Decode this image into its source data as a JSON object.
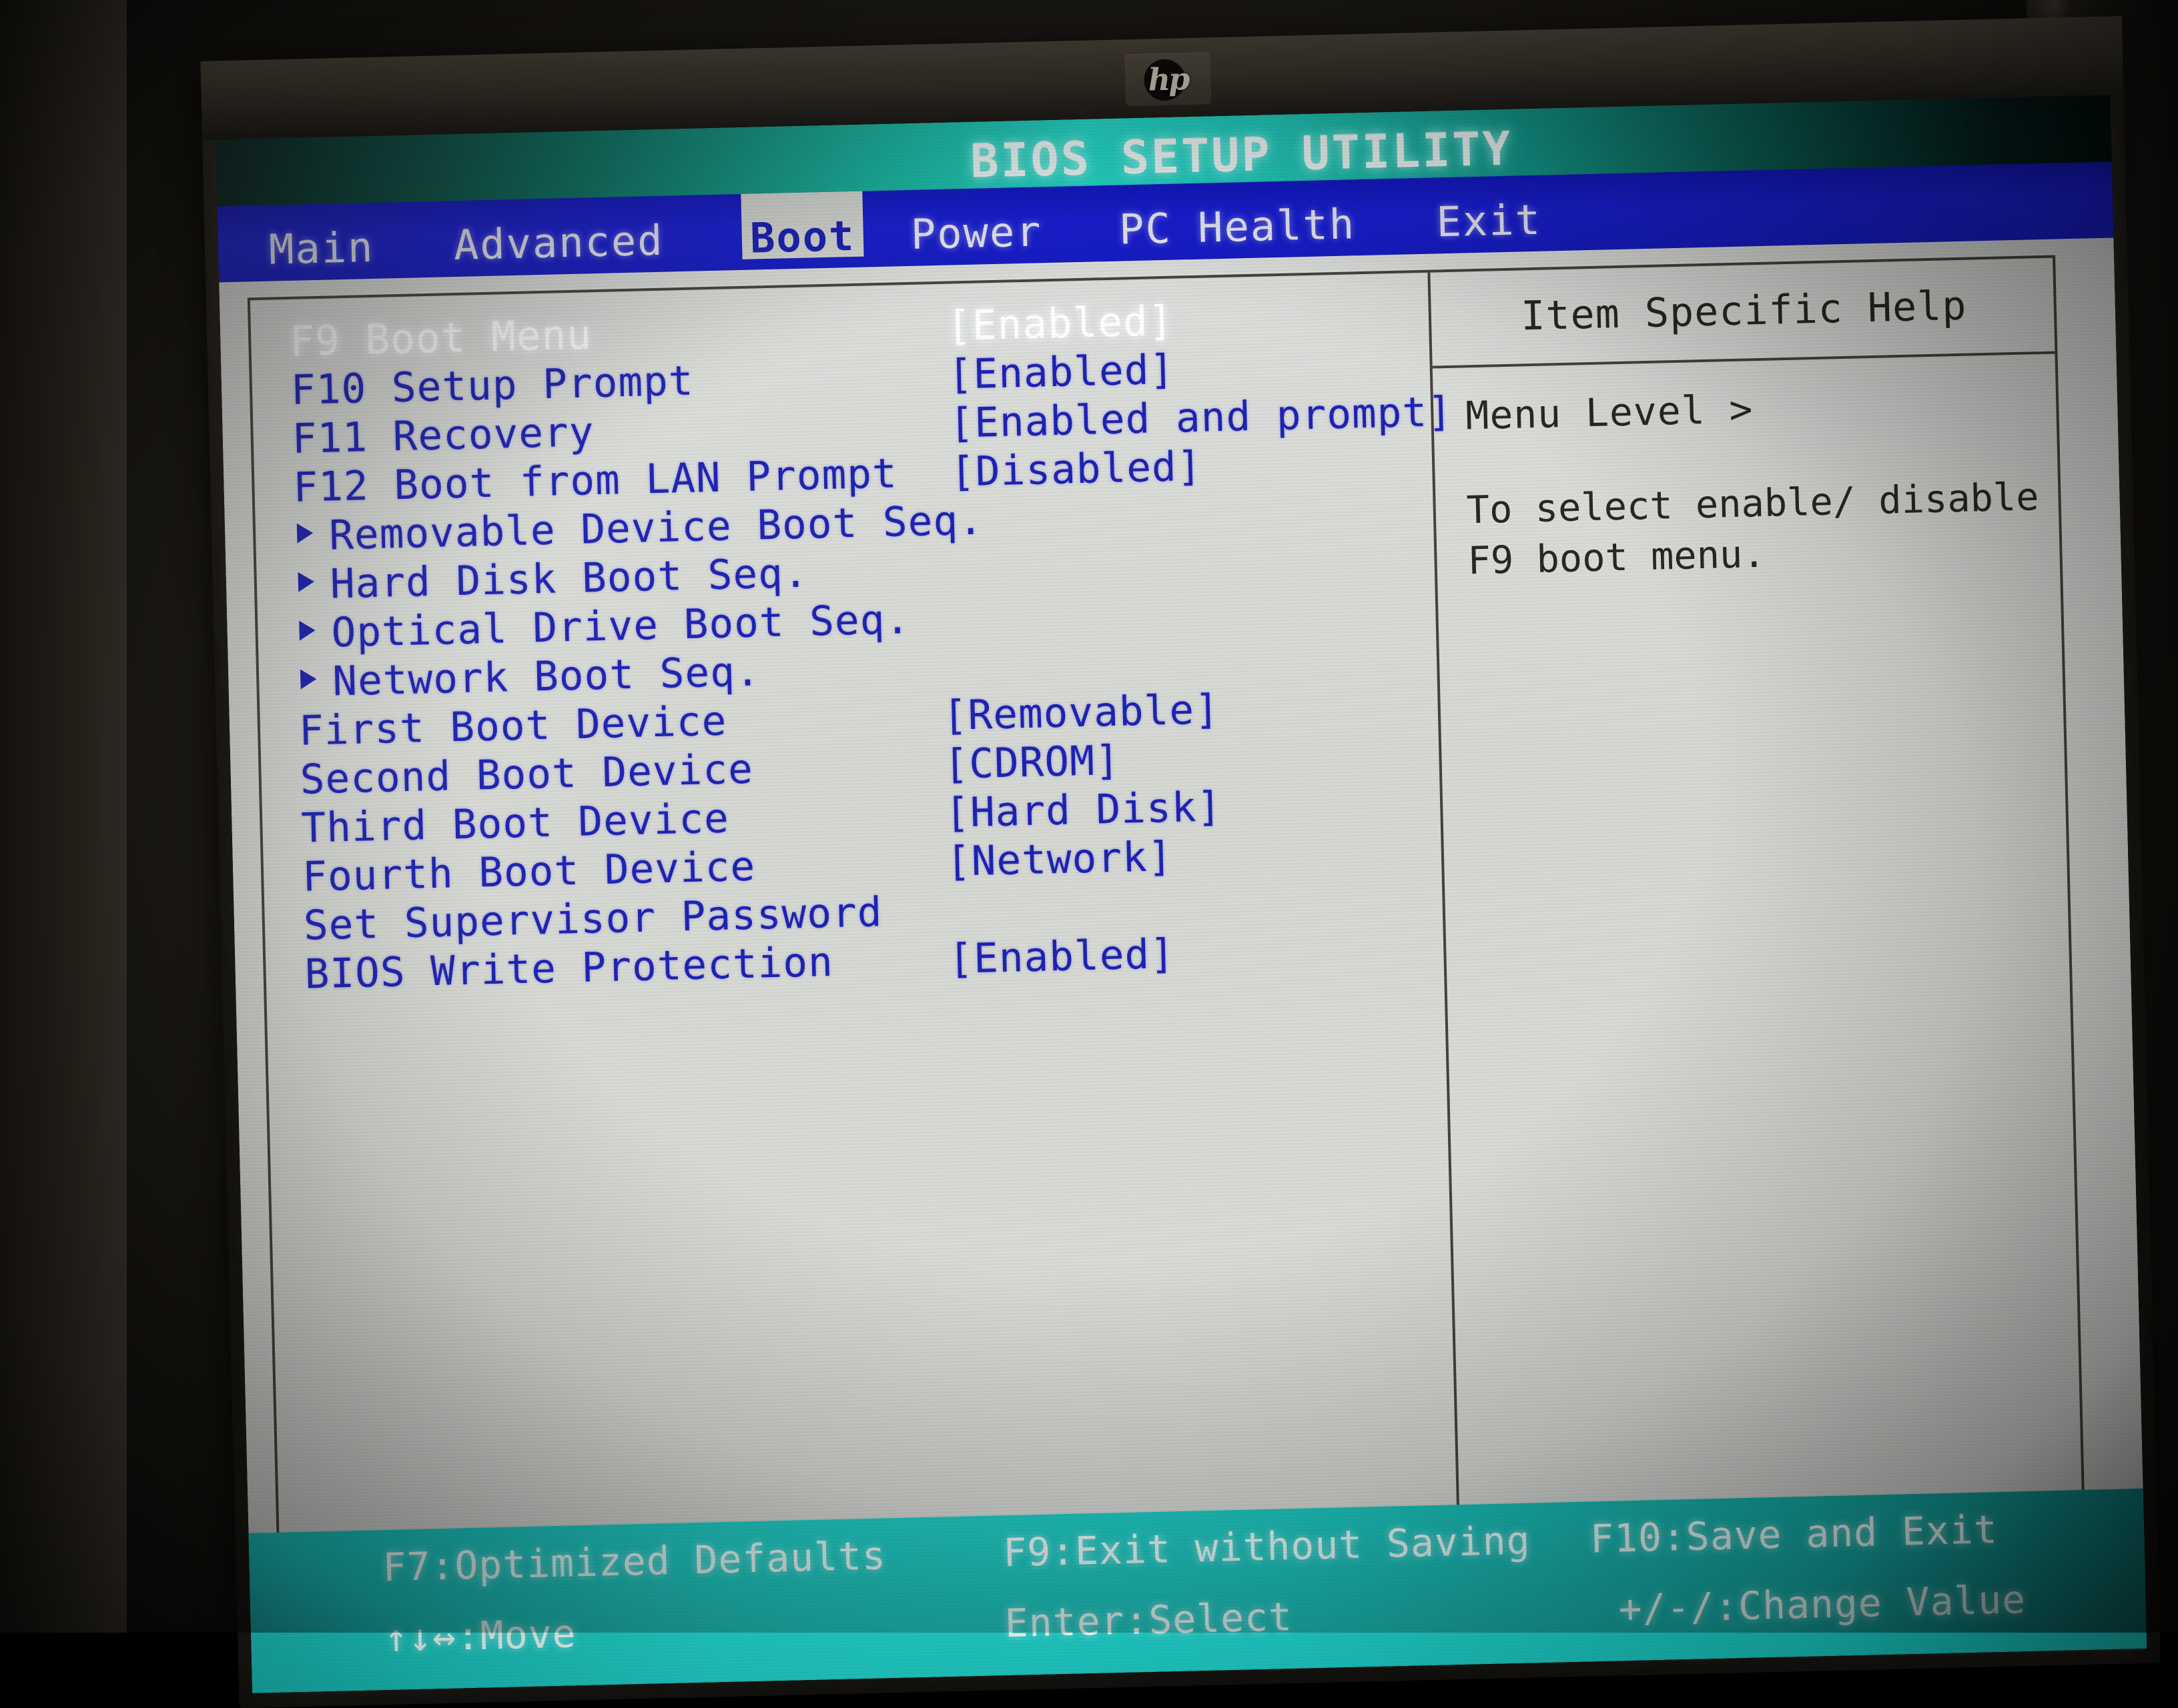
{
  "device": {
    "brand_logo": "hp-logo"
  },
  "header": {
    "title": "BIOS SETUP UTILITY"
  },
  "menubar": {
    "tabs": [
      {
        "label": "Main",
        "selected": false
      },
      {
        "label": "Advanced",
        "selected": false
      },
      {
        "label": "Boot",
        "selected": true
      },
      {
        "label": "Power",
        "selected": false
      },
      {
        "label": "PC Health",
        "selected": false
      },
      {
        "label": "Exit",
        "selected": false
      }
    ]
  },
  "settings": {
    "rows": [
      {
        "label": "F9 Boot Menu",
        "value": "[Enabled]",
        "selected": true,
        "submenu": false
      },
      {
        "label": "F10 Setup Prompt",
        "value": "[Enabled]",
        "selected": false,
        "submenu": false
      },
      {
        "label": "F11 Recovery",
        "value": "[Enabled and prompt]",
        "selected": false,
        "submenu": false
      },
      {
        "label": "F12 Boot from LAN Prompt",
        "value": "[Disabled]",
        "selected": false,
        "submenu": false
      },
      {
        "label": "Removable Device Boot Seq.",
        "value": "",
        "selected": false,
        "submenu": true
      },
      {
        "label": "Hard Disk Boot Seq.",
        "value": "",
        "selected": false,
        "submenu": true
      },
      {
        "label": "Optical Drive Boot Seq.",
        "value": "",
        "selected": false,
        "submenu": true
      },
      {
        "label": "Network Boot Seq.",
        "value": "",
        "selected": false,
        "submenu": true
      },
      {
        "label": "First Boot Device",
        "value": "[Removable]",
        "selected": false,
        "submenu": false
      },
      {
        "label": "Second Boot Device",
        "value": "[CDROM]",
        "selected": false,
        "submenu": false
      },
      {
        "label": "Third Boot Device",
        "value": "[Hard Disk]",
        "selected": false,
        "submenu": false
      },
      {
        "label": "Fourth Boot Device",
        "value": "[Network]",
        "selected": false,
        "submenu": false
      },
      {
        "label": "Set Supervisor Password",
        "value": "",
        "selected": false,
        "submenu": false
      },
      {
        "label": "BIOS Write Protection",
        "value": "[Enabled]",
        "selected": false,
        "submenu": false
      }
    ]
  },
  "help": {
    "title": "Item Specific Help",
    "menu_level": "Menu Level >",
    "text": "To select enable/ disable F9 boot menu."
  },
  "statusbar": {
    "row1": [
      "F7:Optimized Defaults",
      "F9:Exit without Saving",
      "F10:Save and Exit"
    ],
    "row2": [
      "↑↓↔:Move",
      "Enter:Select",
      "+/-/:Change Value"
    ]
  },
  "colors": {
    "header_teal": "#23cfc0",
    "menubar_blue": "#1a1fd8",
    "text_blue": "#1e22b4",
    "selected_white": "#ffffff",
    "lcd_background": "#d7d9d4",
    "status_teal": "#1ec9c3",
    "help_text": "#2a2620"
  }
}
